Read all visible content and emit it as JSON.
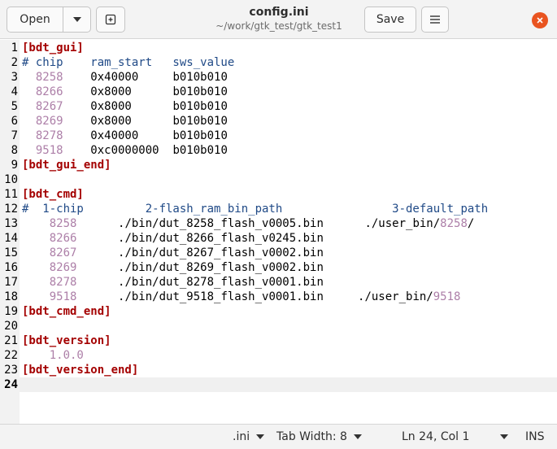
{
  "header": {
    "open_label": "Open",
    "title": "config.ini",
    "subtitle": "~/work/gtk_test/gtk_test1",
    "save_label": "Save"
  },
  "colors": {
    "section": "#a40000",
    "comment": "#204a87",
    "number": "#ad7fa8",
    "close_button": "#e95420",
    "current_line": "#f0f0f0"
  },
  "editor": {
    "current_line": "24",
    "lines": [
      {
        "n": "1",
        "segs": [
          {
            "t": "[bdt_gui]",
            "c": "sec"
          }
        ]
      },
      {
        "n": "2",
        "segs": [
          {
            "t": "# chip    ram_start   sws_value",
            "c": "cm"
          }
        ]
      },
      {
        "n": "3",
        "segs": [
          {
            "t": "  ",
            "c": ""
          },
          {
            "t": "8258",
            "c": "num"
          },
          {
            "t": "    0x40000     b010b010",
            "c": ""
          }
        ]
      },
      {
        "n": "4",
        "segs": [
          {
            "t": "  ",
            "c": ""
          },
          {
            "t": "8266",
            "c": "num"
          },
          {
            "t": "    0x8000      b010b010",
            "c": ""
          }
        ]
      },
      {
        "n": "5",
        "segs": [
          {
            "t": "  ",
            "c": ""
          },
          {
            "t": "8267",
            "c": "num"
          },
          {
            "t": "    0x8000      b010b010",
            "c": ""
          }
        ]
      },
      {
        "n": "6",
        "segs": [
          {
            "t": "  ",
            "c": ""
          },
          {
            "t": "8269",
            "c": "num"
          },
          {
            "t": "    0x8000      b010b010",
            "c": ""
          }
        ]
      },
      {
        "n": "7",
        "segs": [
          {
            "t": "  ",
            "c": ""
          },
          {
            "t": "8278",
            "c": "num"
          },
          {
            "t": "    0x40000     b010b010",
            "c": ""
          }
        ]
      },
      {
        "n": "8",
        "segs": [
          {
            "t": "  ",
            "c": ""
          },
          {
            "t": "9518",
            "c": "num"
          },
          {
            "t": "    0xc0000000  b010b010",
            "c": ""
          }
        ]
      },
      {
        "n": "9",
        "segs": [
          {
            "t": "[bdt_gui_end]",
            "c": "sec"
          }
        ]
      },
      {
        "n": "10",
        "segs": []
      },
      {
        "n": "11",
        "segs": [
          {
            "t": "[bdt_cmd]",
            "c": "sec"
          }
        ]
      },
      {
        "n": "12",
        "segs": [
          {
            "t": "#  1-chip         2-flash_ram_bin_path                3-default_path",
            "c": "cm"
          }
        ]
      },
      {
        "n": "13",
        "segs": [
          {
            "t": "    ",
            "c": ""
          },
          {
            "t": "8258",
            "c": "num"
          },
          {
            "t": "      ./bin/dut_8258_flash_v0005.bin      ./user_bin/",
            "c": ""
          },
          {
            "t": "8258",
            "c": "num"
          },
          {
            "t": "/",
            "c": ""
          }
        ]
      },
      {
        "n": "14",
        "segs": [
          {
            "t": "    ",
            "c": ""
          },
          {
            "t": "8266",
            "c": "num"
          },
          {
            "t": "      ./bin/dut_8266_flash_v0245.bin",
            "c": ""
          }
        ]
      },
      {
        "n": "15",
        "segs": [
          {
            "t": "    ",
            "c": ""
          },
          {
            "t": "8267",
            "c": "num"
          },
          {
            "t": "      ./bin/dut_8267_flash_v0002.bin",
            "c": ""
          }
        ]
      },
      {
        "n": "16",
        "segs": [
          {
            "t": "    ",
            "c": ""
          },
          {
            "t": "8269",
            "c": "num"
          },
          {
            "t": "      ./bin/dut_8269_flash_v0002.bin",
            "c": ""
          }
        ]
      },
      {
        "n": "17",
        "segs": [
          {
            "t": "    ",
            "c": ""
          },
          {
            "t": "8278",
            "c": "num"
          },
          {
            "t": "      ./bin/dut_8278_flash_v0001.bin",
            "c": ""
          }
        ]
      },
      {
        "n": "18",
        "segs": [
          {
            "t": "    ",
            "c": ""
          },
          {
            "t": "9518",
            "c": "num"
          },
          {
            "t": "      ./bin/dut_9518_flash_v0001.bin     ./user_bin/",
            "c": ""
          },
          {
            "t": "9518",
            "c": "num"
          }
        ]
      },
      {
        "n": "19",
        "segs": [
          {
            "t": "[bdt_cmd_end]",
            "c": "sec"
          }
        ]
      },
      {
        "n": "20",
        "segs": []
      },
      {
        "n": "21",
        "segs": [
          {
            "t": "[bdt_version]",
            "c": "sec"
          }
        ]
      },
      {
        "n": "22",
        "segs": [
          {
            "t": "    ",
            "c": ""
          },
          {
            "t": "1.0.0",
            "c": "num"
          }
        ]
      },
      {
        "n": "23",
        "segs": [
          {
            "t": "[bdt_version_end]",
            "c": "sec"
          }
        ]
      },
      {
        "n": "24",
        "segs": []
      }
    ]
  },
  "statusbar": {
    "language": ".ini",
    "tab_width": "Tab Width: 8",
    "position": "Ln 24, Col 1",
    "mode": "INS"
  }
}
